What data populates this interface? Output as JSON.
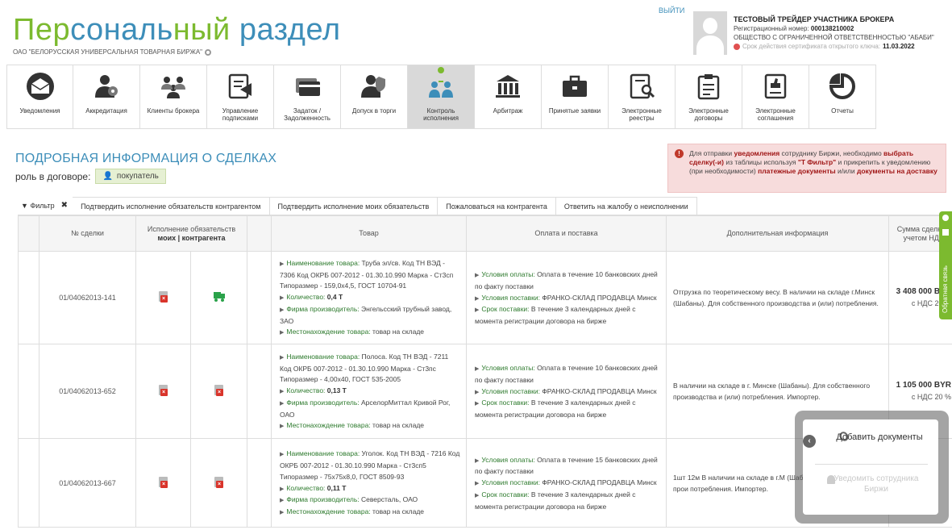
{
  "header": {
    "title_part1": "Пер",
    "title_part2": "сональ",
    "title_part3": "ный ",
    "title_part4": "раздел",
    "exchange": "ОАО \"БЕЛОРУССКАЯ УНИВЕРСАЛЬНАЯ ТОВАРНАЯ БИРЖА\"",
    "logout": "ВЫЙТИ",
    "user_name": "ТЕСТОВЫЙ ТРЕЙДЕР УЧАСТНИКА БРОКЕРА",
    "reg_label": "Регистрационный номер: ",
    "reg_number": "000138210002",
    "company": "ОБЩЕСТВО С ОГРАНИЧЕННОЙ ОТВЕТСТВЕННОСТЬЮ \"АБАБИ\"",
    "cert_label": "Срок действия сертификата открытого ключа: ",
    "cert_date": "11.03.2022"
  },
  "toolbar": [
    {
      "label": "Уведомления",
      "icon": "envelope-icon"
    },
    {
      "label": "Аккредитация",
      "icon": "user-gear-icon"
    },
    {
      "label": "Клиенты брокера",
      "icon": "clients-icon"
    },
    {
      "label": "Управление подписками",
      "icon": "subscription-icon"
    },
    {
      "label": "Задаток / Задолженность",
      "icon": "card-icon"
    },
    {
      "label": "Допуск в торги",
      "icon": "user-shield-icon"
    },
    {
      "label": "Контроль исполнения",
      "icon": "control-icon"
    },
    {
      "label": "Арбитраж",
      "icon": "court-icon"
    },
    {
      "label": "Принятые заявки",
      "icon": "briefcase-icon"
    },
    {
      "label": "Электронные реестры",
      "icon": "registry-icon"
    },
    {
      "label": "Электронные договоры",
      "icon": "contract-icon"
    },
    {
      "label": "Электронные соглашения",
      "icon": "agreement-icon"
    },
    {
      "label": "Отчеты",
      "icon": "pie-chart-icon"
    }
  ],
  "section": {
    "title": "ПОДРОБНАЯ ИНФОРМАЦИЯ О СДЕЛКАХ",
    "role_label": "роль в договоре:",
    "role_value": "покупатель"
  },
  "notice": {
    "p1": "Для отправки ",
    "p2": "уведомления",
    "p3": " сотруднику Биржи, необходимо ",
    "p4": "выбрать сделку(-и)",
    "p5": " из таблицы используя ",
    "p6": "\"Т Фильтр\"",
    "p7": " и прикрепить к уведомлению (при необходимости) ",
    "p8": "платежные документы",
    "p9": " и/или ",
    "p10": "документы на доставку"
  },
  "tabs": {
    "filter": "Фильтр",
    "close": "✖",
    "t1": "Подтвердить исполнение обязательств контрагентом",
    "t2": "Подтвердить исполнение моих обязательств",
    "t3": "Пожаловаться на контрагента",
    "t4": "Ответить на жалобу о неисполнении"
  },
  "table": {
    "headers": {
      "deal": "№ сделки",
      "exec": "Исполнение обязательств",
      "exec_sub": "моих | контрагента",
      "goods": "Товар",
      "pay": "Оплата и поставка",
      "info": "Дополнительная информация",
      "sum": "Сумма сделки (с учетом НДС)"
    },
    "labels": {
      "goods_name": "Наименование товара: ",
      "qty": "Количество: ",
      "maker": "Фирма производитель: ",
      "location": "Местонахождение товара: ",
      "pay_terms": "Условия оплаты: ",
      "delivery": "Условия поставки: ",
      "term": "Срок поставки: "
    },
    "rows": [
      {
        "deal": "01/04062013-141",
        "goods": "Труба эл/св. Код ТН ВЭД - 7306 Код ОКРБ 007-2012 - 01.30.10.990 Марка - Ст3сп Типоразмер - 159,0х4,5, ГОСТ 10704-91",
        "qty": "0,4 Т",
        "maker": "Энгельсский трубный завод, ЗАО",
        "location": "товар на складе",
        "pay": "Оплата в течение 10 банковских дней по факту поставки",
        "delivery": "ФРАНКО-СКЛАД ПРОДАВЦА Минск",
        "term": "В течение 3 календарных дней с момента регистрации договора на бирже",
        "info": "Отгрузка по теоретическому весу. В наличии на складе г.Минск (Шабаны). Для собственного производства и (или) потребления.",
        "amount": "3 408 000 BYR",
        "vat": "с НДС 20 %"
      },
      {
        "deal": "01/04062013-652",
        "goods": "Полоса. Код ТН ВЭД - 7211 Код ОКРБ 007-2012 - 01.30.10.990 Марка - Ст3пс Типоразмер - 4,00х40, ГОСТ 535-2005",
        "qty": "0,13 Т",
        "maker": "АрселорМиттал Кривой Рог, ОАО",
        "location": "товар на складе",
        "pay": "Оплата в течение 10 банковских дней по факту поставки",
        "delivery": "ФРАНКО-СКЛАД ПРОДАВЦА Минск",
        "term": "В течение 3 календарных дней с момента регистрации договора на бирже",
        "info": "В наличии на складе в г. Минске (Шабаны). Для собственного производства и (или) потребления. Импортер.",
        "amount": "1 105 000 BYR",
        "vat": "с НДС 20 %"
      },
      {
        "deal": "01/04062013-667",
        "goods": "Уголок. Код ТН ВЭД - 7216 Код ОКРБ 007-2012 - 01.30.10.990 Марка - Ст3сп5 Типоразмер - 75х75х8,0, ГОСТ 8509-93",
        "qty": "0,11 Т",
        "maker": "Северсталь, ОАО",
        "location": "товар на складе",
        "pay": "Оплата в течение 15 банковских дней по факту поставки",
        "delivery": "ФРАНКО-СКЛАД ПРОДАВЦА Минск",
        "term": "В течение 3 календарных дней с момента регистрации договора на бирже",
        "info": "1шт 12м В наличии на складе в г.М (Шабаны). Для собственного прои потребления. Импортер.",
        "amount": "",
        "vat": ""
      }
    ]
  },
  "feedback": "Обратная связь",
  "float_panel": {
    "toggle": "‹",
    "add_docs": "Добавить документы",
    "notify": "Уведомить сотрудника Биржи"
  }
}
